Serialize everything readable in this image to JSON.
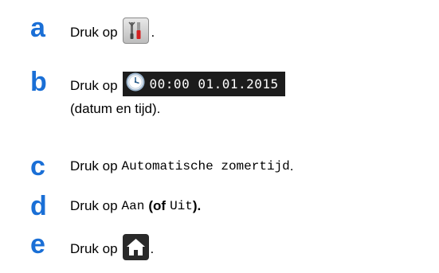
{
  "steps": {
    "a": {
      "letter": "a",
      "text": "Druk op",
      "suffix": ".",
      "icon": "tools-icon"
    },
    "b": {
      "letter": "b",
      "text": "Druk op",
      "clock_value": "00:00 01.01.2015",
      "line2": "(datum en tijd).",
      "icon": "clock-icon"
    },
    "c": {
      "letter": "c",
      "text": "Druk op",
      "option": "Automatische zomertijd",
      "suffix": "."
    },
    "d": {
      "letter": "d",
      "text": "Druk op",
      "on": "Aan",
      "open": "(of",
      "off": "Uit",
      "close": ")."
    },
    "e": {
      "letter": "e",
      "text": "Druk op",
      "suffix": ".",
      "icon": "home-icon"
    }
  },
  "colors": {
    "step_letter": "#1a6fd6",
    "home_button": "#2a2a2a",
    "clock_bar": "#1c1c1c"
  }
}
